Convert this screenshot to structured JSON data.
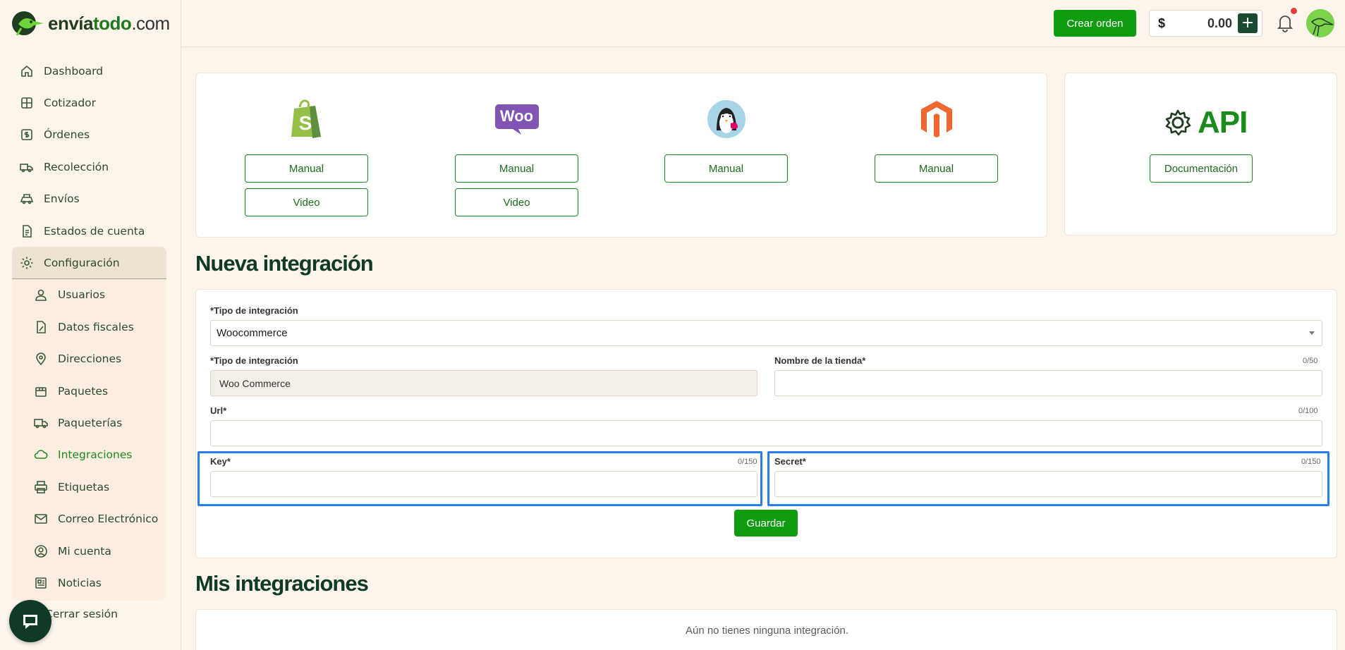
{
  "brand": {
    "name_part1": "envía",
    "name_part2": "todo",
    "name_part3": ".com",
    "accent": "#109c10",
    "dark": "#0f3a26"
  },
  "header": {
    "create_label": "Crear orden",
    "currency": "$",
    "balance": "0.00",
    "add_icon": "plus-icon"
  },
  "sidebar": {
    "items": [
      {
        "label": "Dashboard",
        "icon": "home-icon"
      },
      {
        "label": "Cotizador",
        "icon": "calculator-icon"
      },
      {
        "label": "Órdenes",
        "icon": "dollar-doc-icon"
      },
      {
        "label": "Recolección",
        "icon": "truck-pickup-icon"
      },
      {
        "label": "Envíos",
        "icon": "shipping-icon"
      },
      {
        "label": "Estados de cuenta",
        "icon": "statement-icon"
      },
      {
        "label": "Configuración",
        "icon": "gear-icon"
      }
    ],
    "subitems": [
      {
        "label": "Usuarios",
        "icon": "user-icon"
      },
      {
        "label": "Datos fiscales",
        "icon": "tax-doc-icon"
      },
      {
        "label": "Direcciones",
        "icon": "location-pin-icon"
      },
      {
        "label": "Paquetes",
        "icon": "package-icon"
      },
      {
        "label": "Paqueterías",
        "icon": "delivery-truck-icon"
      },
      {
        "label": "Integraciones",
        "icon": "cloud-icon"
      },
      {
        "label": "Etiquetas",
        "icon": "printer-icon"
      },
      {
        "label": "Correo Electrónico",
        "icon": "envelope-icon"
      },
      {
        "label": "Mi cuenta",
        "icon": "account-icon"
      },
      {
        "label": "Noticias",
        "icon": "news-icon"
      }
    ],
    "logout": "Cerrar sesión"
  },
  "platforms": {
    "shopify": {
      "manual": "Manual",
      "video": "Video"
    },
    "woo": {
      "logo_text": "Woo",
      "manual": "Manual",
      "video": "Video"
    },
    "prestashop": {
      "manual": "Manual"
    },
    "magento": {
      "manual": "Manual"
    },
    "api": {
      "logo_text": "API",
      "doc": "Documentación"
    }
  },
  "new_integration": {
    "title": "Nueva integración",
    "type_label": "Tipo de integración",
    "type_value": "Woocommerce",
    "type2_label": "Tipo de integración",
    "type2_value": "Woo Commerce",
    "store_label": "Nombre de la tienda",
    "store_counter": "0/50",
    "store_value": "",
    "url_label": "Url",
    "url_counter": "0/100",
    "url_value": "",
    "key_label": "Key",
    "key_counter": "0/150",
    "key_value": "",
    "secret_label": "Secret",
    "secret_counter": "0/150",
    "secret_value": "",
    "save_label": "Guardar"
  },
  "my_integrations": {
    "title": "Mis integraciones",
    "empty": "Aún no tienes ninguna integración."
  }
}
